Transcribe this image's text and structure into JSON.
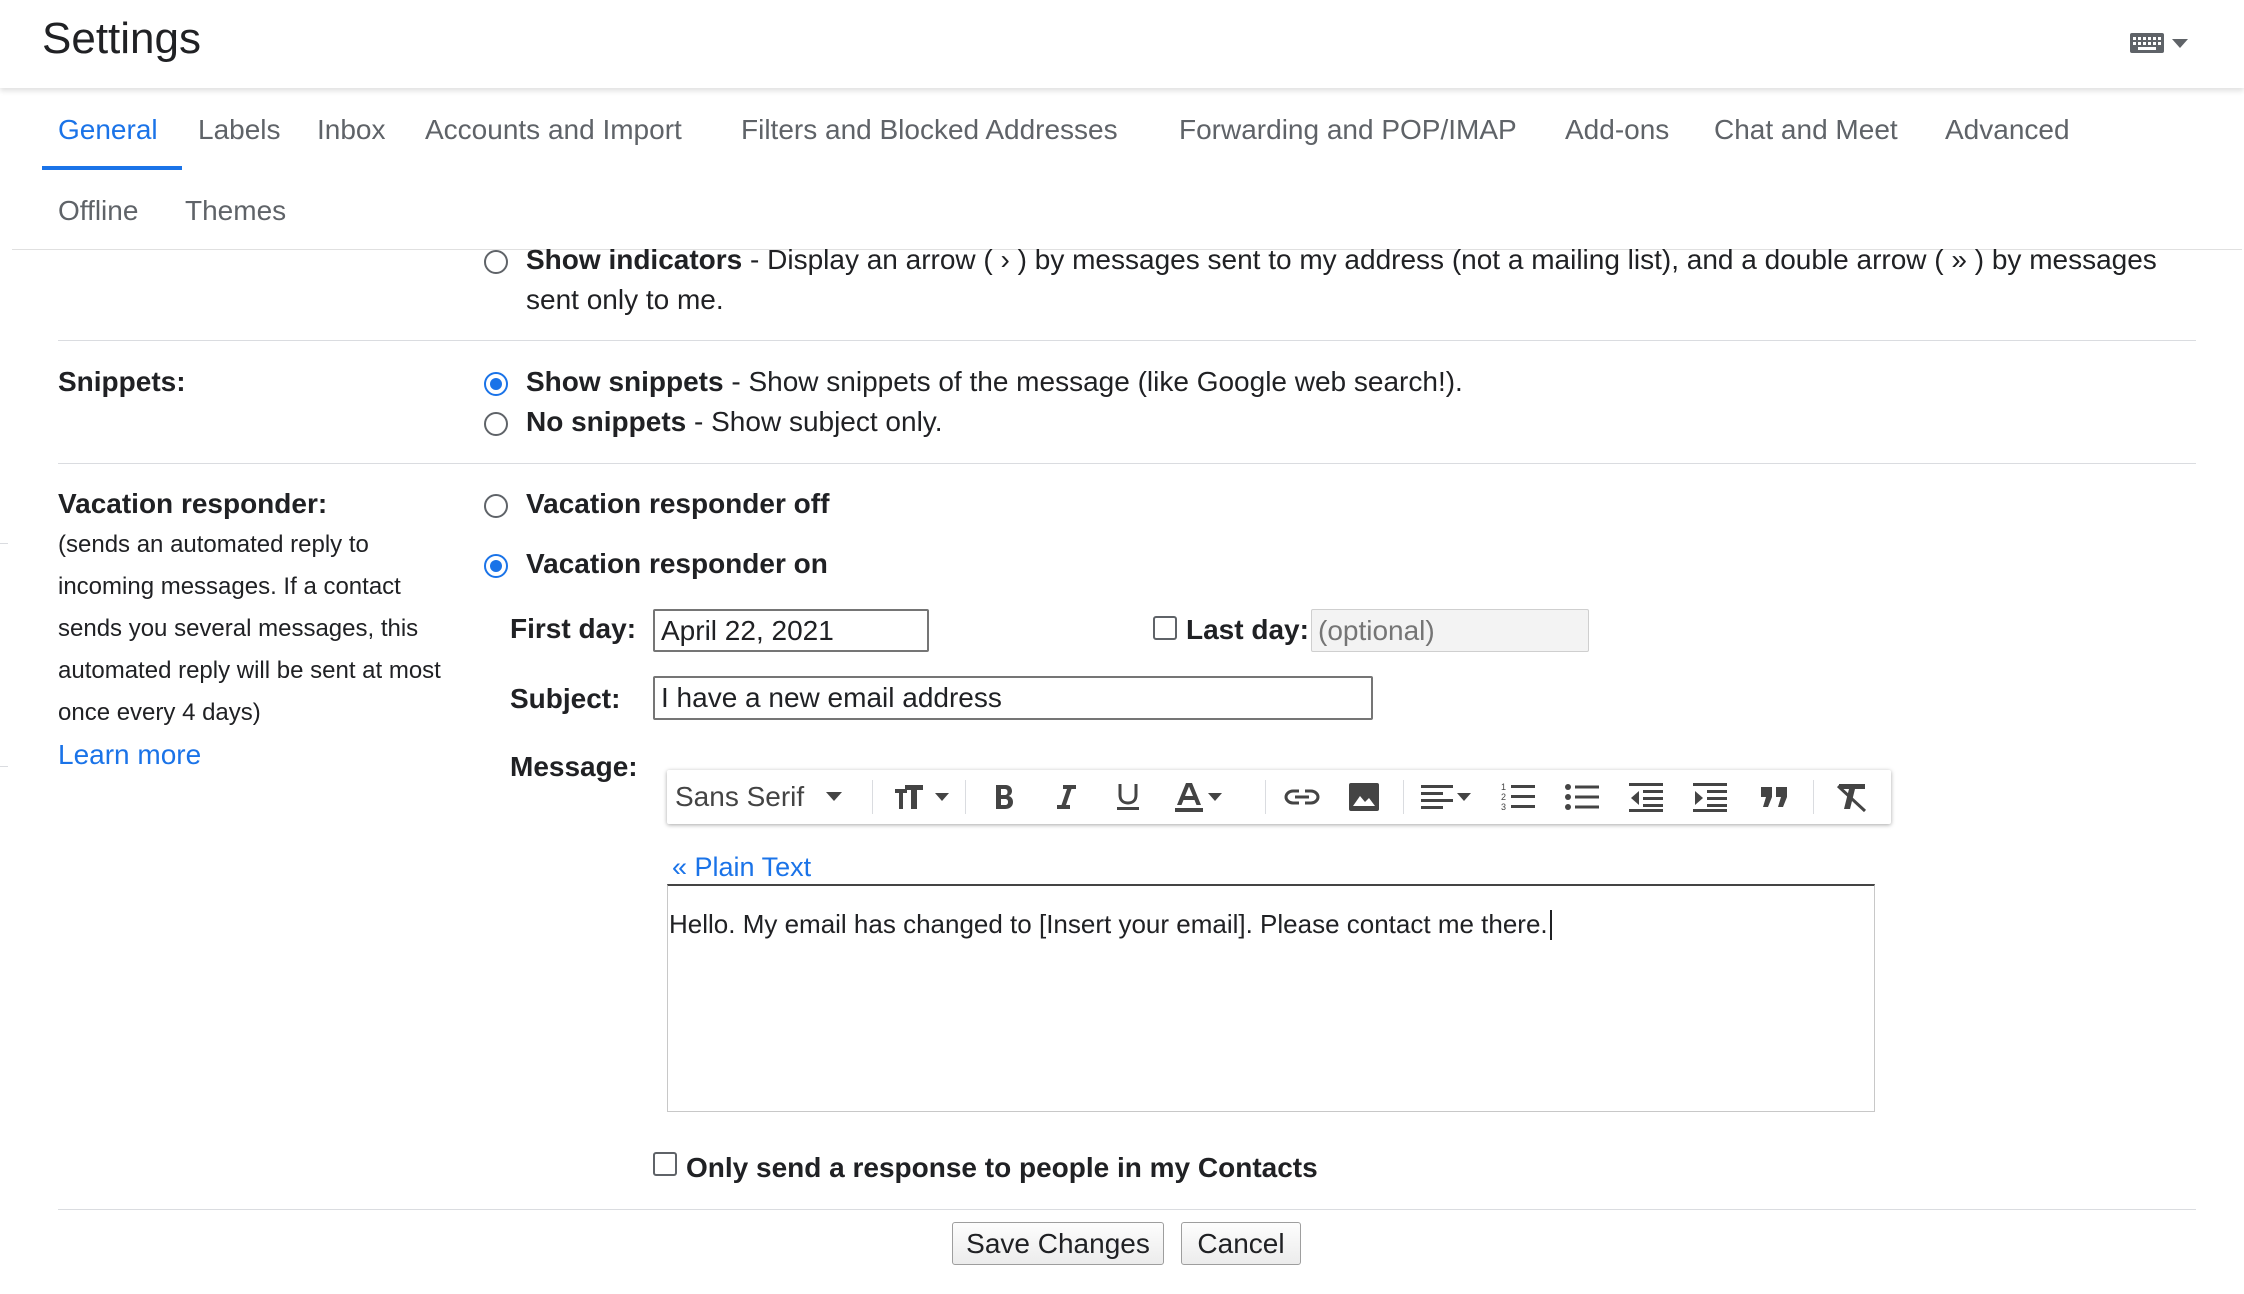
{
  "header": {
    "title": "Settings",
    "keyboard_icon": "keyboard-icon"
  },
  "tabs": [
    {
      "label": "General",
      "active": true
    },
    {
      "label": "Labels"
    },
    {
      "label": "Inbox"
    },
    {
      "label": "Accounts and Import"
    },
    {
      "label": "Filters and Blocked Addresses"
    },
    {
      "label": "Forwarding and POP/IMAP"
    },
    {
      "label": "Add-ons"
    },
    {
      "label": "Chat and Meet"
    },
    {
      "label": "Advanced"
    },
    {
      "label": "Offline"
    },
    {
      "label": "Themes"
    }
  ],
  "indicators": {
    "bold": "Show indicators",
    "desc": " - Display an arrow ( › ) by messages sent to my address (not a mailing list), and a double arrow ( » ) by messages",
    "desc2": "sent only to me."
  },
  "snippets": {
    "label": "Snippets:",
    "show_bold": "Show snippets",
    "show_desc": " - Show snippets of the message (like Google web search!).",
    "none_bold": "No snippets",
    "none_desc": " - Show subject only.",
    "selected": "show"
  },
  "vacation": {
    "label": "Vacation responder:",
    "desc_lines": [
      "(sends an automated reply to",
      "incoming messages. If a contact",
      "sends you several messages, this",
      "automated reply will be sent at most",
      "once every 4 days)"
    ],
    "learn_more": "Learn more",
    "off_label": "Vacation responder off",
    "on_label": "Vacation responder on",
    "selected": "on",
    "first_day_label": "First day:",
    "first_day_value": "April 22, 2021",
    "last_day_label": "Last day:",
    "last_day_placeholder": "(optional)",
    "subject_label": "Subject:",
    "subject_value": "I have a new email address",
    "message_label": "Message:",
    "font_name": "Sans Serif",
    "plain_text_link": "« Plain Text",
    "message_body": "Hello. My email has changed to [Insert your email]. Please contact me there.",
    "contacts_only_label": "Only send a response to people in my Contacts"
  },
  "actions": {
    "save": "Save Changes",
    "cancel": "Cancel"
  },
  "colors": {
    "accent": "#1a73e8",
    "text": "#202124",
    "muted": "#5f6368"
  }
}
